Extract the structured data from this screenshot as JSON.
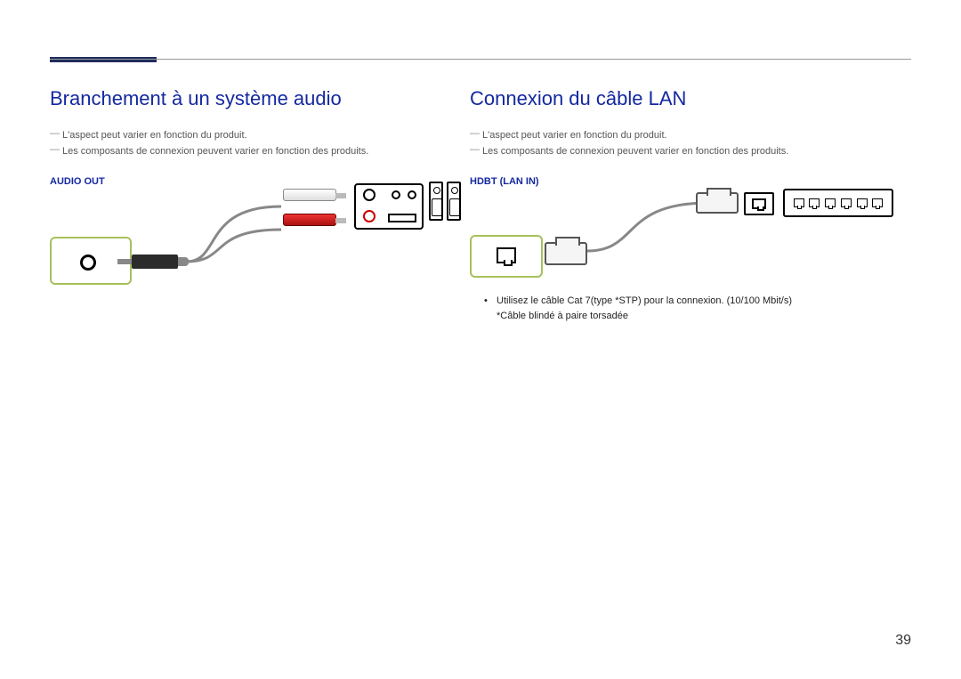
{
  "page_number": "39",
  "left": {
    "title": "Branchement à un système audio",
    "note1": "L'aspect peut varier en fonction du produit.",
    "note2": "Les composants de connexion peuvent varier en fonction des produits.",
    "port_label": "AUDIO OUT"
  },
  "right": {
    "title": "Connexion du câble LAN",
    "note1": "L'aspect peut varier en fonction du produit.",
    "note2": "Les composants de connexion peuvent varier en fonction des produits.",
    "port_label": "HDBT (LAN IN)",
    "bullet1_line1": "Utilisez le câble Cat 7(type *STP) pour la connexion. (10/100 Mbit/s)",
    "bullet1_line2": "*Câble blindé à paire torsadée"
  }
}
